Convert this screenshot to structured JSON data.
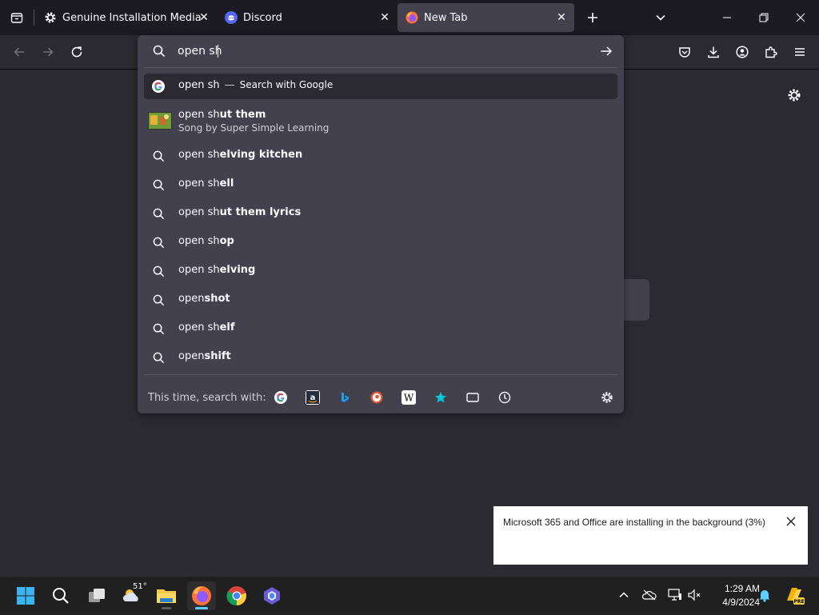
{
  "tabs": [
    {
      "title": "Genuine Installation Media",
      "icon": "gear-icon",
      "active": false
    },
    {
      "title": "Discord",
      "icon": "discord-icon",
      "active": false
    },
    {
      "title": "New Tab",
      "icon": "firefox-icon",
      "active": true
    }
  ],
  "urlbar": {
    "value": "open sh"
  },
  "suggestions": [
    {
      "typed": "open sh",
      "rest": "",
      "suffix": "Search with Google",
      "icon": "google-icon",
      "selected": true
    },
    {
      "typed": "open sh",
      "rest": "ut them",
      "subtitle": "Song by Super Simple Learning",
      "icon": "video-thumbnail"
    },
    {
      "typed": "open sh",
      "rest": "elving kitchen",
      "icon": "search-icon"
    },
    {
      "typed": "open sh",
      "rest": "ell",
      "icon": "search-icon"
    },
    {
      "typed": "open sh",
      "rest": "ut them lyrics",
      "icon": "search-icon"
    },
    {
      "typed": "open sh",
      "rest": "op",
      "icon": "search-icon"
    },
    {
      "typed": "open sh",
      "rest": "elving",
      "icon": "search-icon"
    },
    {
      "typed": "open",
      "rest": "shot",
      "icon": "search-icon"
    },
    {
      "typed": "open sh",
      "rest": "elf",
      "icon": "search-icon"
    },
    {
      "typed": "open",
      "rest": "shift",
      "icon": "search-icon"
    }
  ],
  "search_with": {
    "label": "This time, search with:",
    "engines": [
      "google",
      "amazon",
      "bing",
      "duckduckgo",
      "wikipedia",
      "bookmarks",
      "tabs",
      "history"
    ]
  },
  "notification": {
    "message": "Microsoft 365 and Office are installing in the background (3%)"
  },
  "taskbar": {
    "weather_temp": "51°",
    "time": "1:29 AM",
    "date": "4/9/2024"
  },
  "colors": {
    "background": "#2b2a33",
    "tabstrip": "#1c1b22",
    "panel": "#42414d",
    "accent": "#60cdff"
  }
}
